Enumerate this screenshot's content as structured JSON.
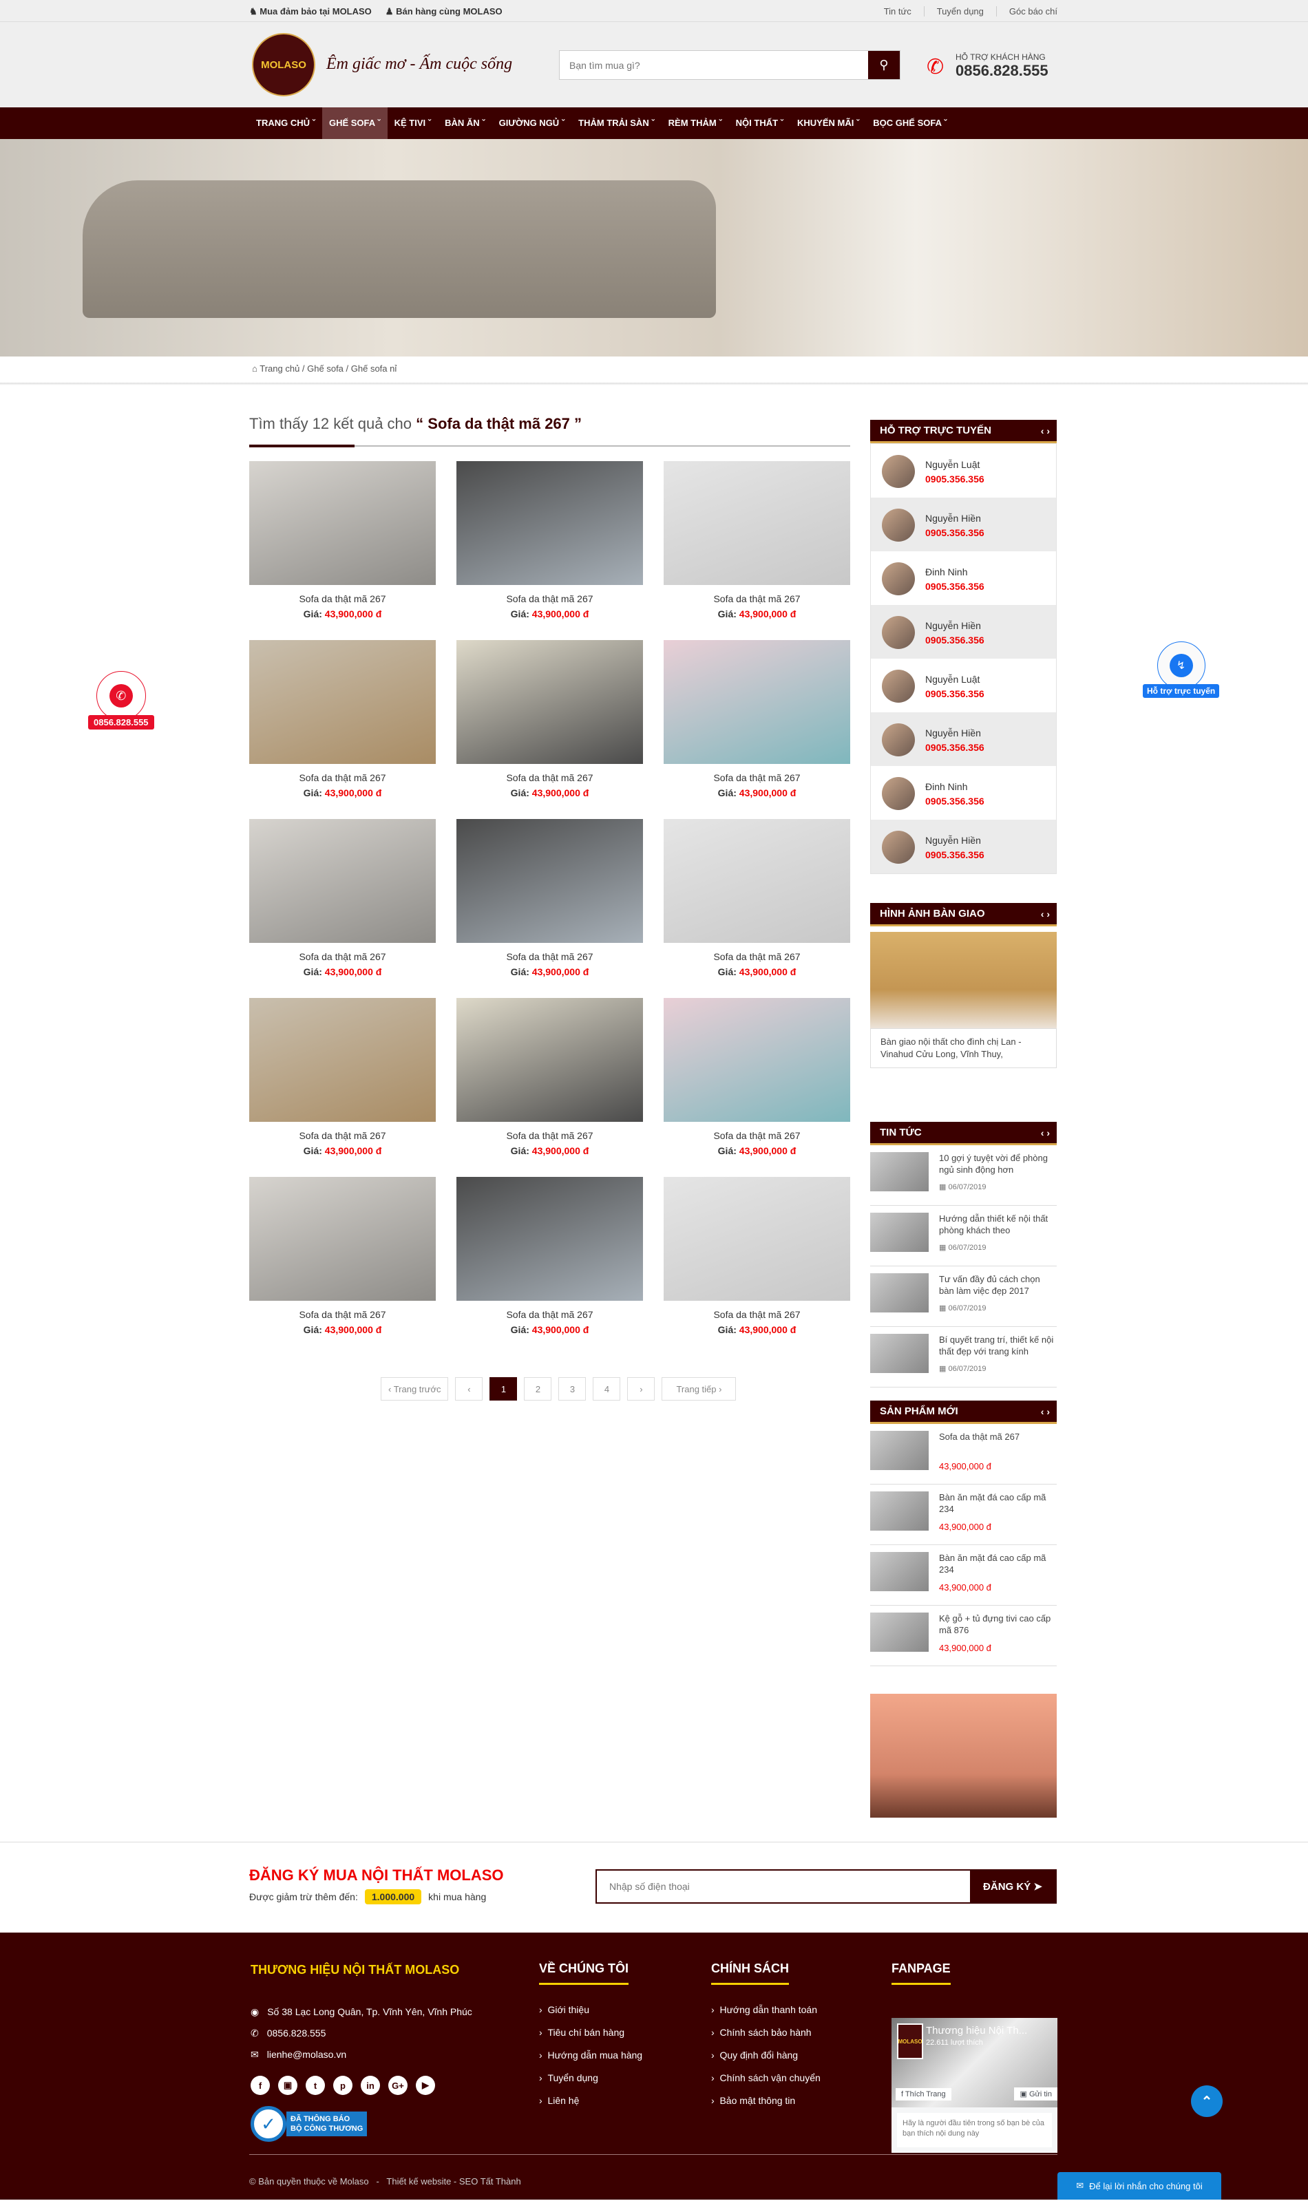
{
  "topbar": {
    "left": [
      "Mua đảm bảo tại MOLASO",
      "Bán hàng cùng MOLASO"
    ],
    "right": [
      "Tin tức",
      "Tuyển dụng",
      "Góc báo chí"
    ]
  },
  "header": {
    "logo_text": "MOLASO",
    "slogan": "Êm giấc mơ - Ấm cuộc sống",
    "search_placeholder": "Bạn tìm mua gì?",
    "hotline_label": "HỖ TRỢ KHÁCH HÀNG",
    "hotline": "0856.828.555"
  },
  "nav": [
    {
      "label": "TRANG CHỦ"
    },
    {
      "label": "GHẾ SOFA",
      "active": true
    },
    {
      "label": "KỆ TIVI"
    },
    {
      "label": "BÀN ĂN"
    },
    {
      "label": "GIƯỜNG NGỦ"
    },
    {
      "label": "THẢM TRẢI SÀN"
    },
    {
      "label": "RÈM THẢM"
    },
    {
      "label": "NỘI THẤT"
    },
    {
      "label": "KHUYẾN MÃI"
    },
    {
      "label": "BỌC GHẾ SOFA"
    }
  ],
  "breadcrumb": [
    "Trang chủ",
    "Ghế sofa",
    "Ghế sofa nỉ"
  ],
  "results": {
    "prefix": "Tìm thấy 12 kết quả cho",
    "query": "“ Sofa da thật mã 267 ”"
  },
  "products": [
    {
      "name": "Sofa da thật mã 267",
      "price_label": "Giá:",
      "price": "43,900,000 đ"
    },
    {
      "name": "Sofa da thật mã 267",
      "price_label": "Giá:",
      "price": "43,900,000 đ"
    },
    {
      "name": "Sofa da thật mã 267",
      "price_label": "Giá:",
      "price": "43,900,000 đ"
    },
    {
      "name": "Sofa da thật mã 267",
      "price_label": "Giá:",
      "price": "43,900,000 đ"
    },
    {
      "name": "Sofa da thật mã 267",
      "price_label": "Giá:",
      "price": "43,900,000 đ"
    },
    {
      "name": "Sofa da thật mã 267",
      "price_label": "Giá:",
      "price": "43,900,000 đ"
    },
    {
      "name": "Sofa da thật mã 267",
      "price_label": "Giá:",
      "price": "43,900,000 đ"
    },
    {
      "name": "Sofa da thật mã 267",
      "price_label": "Giá:",
      "price": "43,900,000 đ"
    },
    {
      "name": "Sofa da thật mã 267",
      "price_label": "Giá:",
      "price": "43,900,000 đ"
    },
    {
      "name": "Sofa da thật mã 267",
      "price_label": "Giá:",
      "price": "43,900,000 đ"
    },
    {
      "name": "Sofa da thật mã 267",
      "price_label": "Giá:",
      "price": "43,900,000 đ"
    },
    {
      "name": "Sofa da thật mã 267",
      "price_label": "Giá:",
      "price": "43,900,000 đ"
    },
    {
      "name": "Sofa da thật mã 267",
      "price_label": "Giá:",
      "price": "43,900,000 đ"
    },
    {
      "name": "Sofa da thật mã 267",
      "price_label": "Giá:",
      "price": "43,900,000 đ"
    },
    {
      "name": "Sofa da thật mã 267",
      "price_label": "Giá:",
      "price": "43,900,000 đ"
    }
  ],
  "pagination": {
    "prev": "‹ Trang trước",
    "prev_arrow": "‹",
    "pages": [
      "1",
      "2",
      "3",
      "4"
    ],
    "current": "1",
    "next_arrow": "›",
    "next": "Trang tiếp ›"
  },
  "support": {
    "title": "HỖ TRỢ TRỰC TUYẾN",
    "arrows": "‹ ›",
    "items": [
      {
        "name": "Nguyễn Luật",
        "phone": "0905.356.356"
      },
      {
        "name": "Nguyễn Hiền",
        "phone": "0905.356.356"
      },
      {
        "name": "Đinh Ninh",
        "phone": "0905.356.356"
      },
      {
        "name": "Nguyễn Hiền",
        "phone": "0905.356.356"
      },
      {
        "name": "Nguyễn Luật",
        "phone": "0905.356.356"
      },
      {
        "name": "Nguyễn Hiền",
        "phone": "0905.356.356"
      },
      {
        "name": "Đinh Ninh",
        "phone": "0905.356.356"
      },
      {
        "name": "Nguyễn Hiền",
        "phone": "0905.356.356"
      }
    ]
  },
  "delivery": {
    "title": "HÌNH ẢNH BÀN GIAO",
    "caption": "Bàn giao nội thất cho đình chị Lan - Vinahud Cửu Long, Vĩnh Thuy,"
  },
  "news": {
    "title": "TIN TỨC",
    "items": [
      {
        "title": "10 gợi ý tuyệt vời để phòng ngủ sinh động hơn",
        "date": "06/07/2019"
      },
      {
        "title": "Hướng dẫn thiết kế nội thất phòng khách theo",
        "date": "06/07/2019"
      },
      {
        "title": "Tư vấn đầy đủ cách chọn bàn làm việc đẹp 2017",
        "date": "06/07/2019"
      },
      {
        "title": "Bí quyết trang trí, thiết kế nội thất đẹp với trang kính",
        "date": "06/07/2019"
      }
    ]
  },
  "new_products": {
    "title": "SẢN PHẨM MỚI",
    "items": [
      {
        "name": "Sofa da thật mã 267",
        "price": "43,900,000 đ"
      },
      {
        "name": "Bàn ăn mặt đá cao cấp mã 234",
        "price": "43,900,000 đ"
      },
      {
        "name": "Bàn ăn mặt đá cao cấp mã 234",
        "price": "43,900,000 đ"
      },
      {
        "name": "Kệ gỗ + tủ đựng tivi cao cấp mã 876",
        "price": "43,900,000 đ"
      }
    ]
  },
  "register": {
    "title": "ĐĂNG KÝ MUA NỘI THẤT MOLASO",
    "text_before": "Được giảm trừ thêm đến:",
    "amount": "1.000.000",
    "text_after": "khi mua hàng",
    "placeholder": "Nhập số điện thoại",
    "button": "ĐĂNG KÝ"
  },
  "footer": {
    "brand": "THƯƠNG HIỆU NỘI THẤT MOLASO",
    "address": "Số 38 Lạc Long Quân, Tp. Vĩnh Yên, Vĩnh Phúc",
    "phone": "0856.828.555",
    "email": "lienhe@molaso.vn",
    "social": [
      "facebook",
      "instagram",
      "twitter",
      "pinterest",
      "linkedin",
      "google-plus",
      "youtube"
    ],
    "badge": {
      "line1": "ĐÃ THÔNG BÁO",
      "line2": "BỘ CÔNG THƯƠNG"
    },
    "about": {
      "title": "VỀ CHÚNG TÔI",
      "links": [
        "Giới thiệu",
        "Tiêu chí bán hàng",
        "Hướng dẫn mua hàng",
        "Tuyển dụng",
        "Liên hệ"
      ]
    },
    "policy": {
      "title": "CHÍNH SÁCH",
      "links": [
        "Hướng dẫn thanh toán",
        "Chính sách bảo hành",
        "Quy định đổi hàng",
        "Chính sách vận chuyển",
        "Bảo mật thông tin"
      ]
    },
    "fanpage": {
      "title": "FANPAGE",
      "page_name": "Thương hiệu Nội Th...",
      "likes": "22.611 lượt thích",
      "like_btn": "Thích Trang",
      "msg_btn": "Gửi tin",
      "note": "Hãy là người đầu tiên trong số bạn bè của bạn thích nội dung này"
    },
    "copyright": "© Bản quyền thuộc về Molaso   -   Thiết kế website - SEO Tất Thành"
  },
  "floating": {
    "call": "0856.828.555",
    "messenger": "Hỗ trợ trực tuyến",
    "leave_message": "Để lại lời nhắn cho chúng tôi"
  },
  "colors": {
    "brand": "#3b0000",
    "accent": "#d9a84a",
    "price": "#ee0000",
    "yellow": "#fbd100",
    "blue": "#1385d8"
  }
}
